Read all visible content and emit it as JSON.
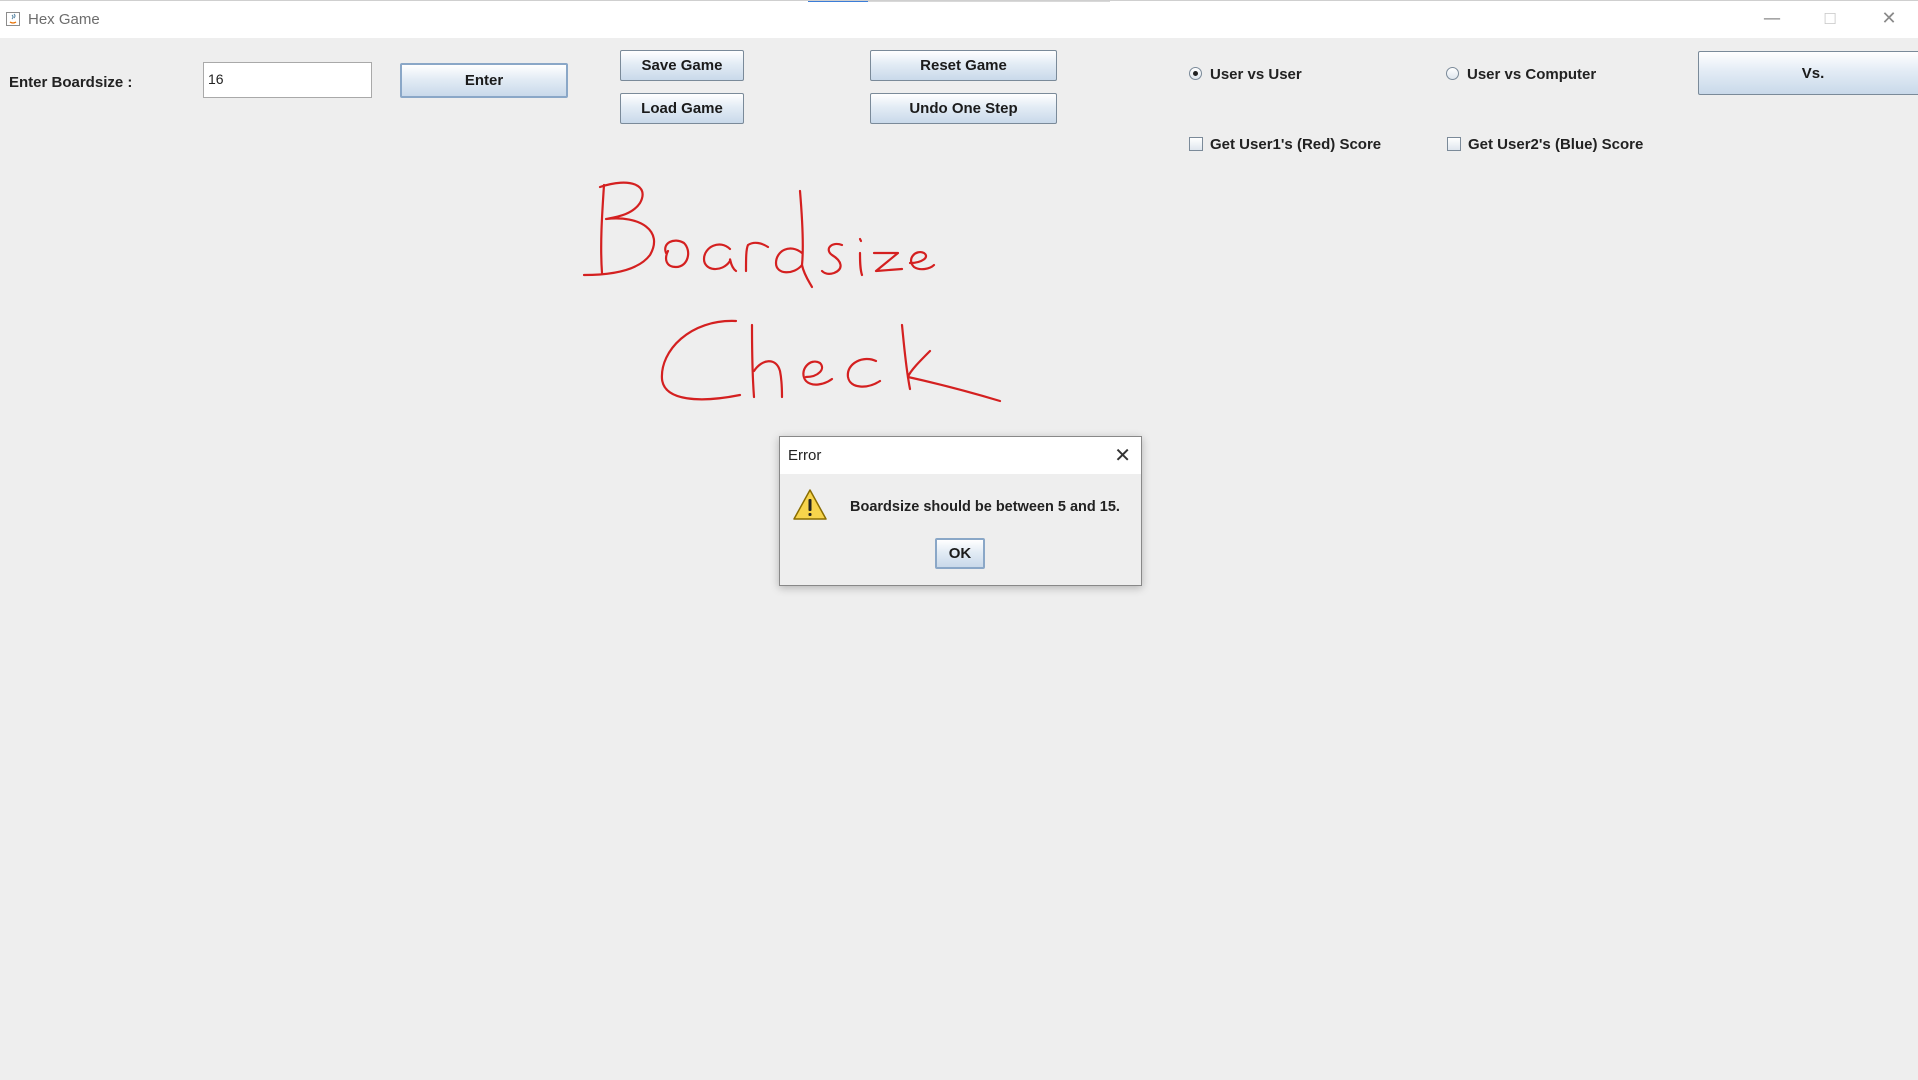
{
  "window": {
    "title": "Hex Game",
    "minimize": "—",
    "maximize": "☐",
    "close": "✕"
  },
  "boardsize": {
    "label": "Enter Boardsize :",
    "value": "16",
    "enter_label": "Enter"
  },
  "buttons": {
    "save": "Save Game",
    "load": "Load Game",
    "reset": "Reset Game",
    "undo": "Undo One Step",
    "vs": "Vs."
  },
  "mode": {
    "options": [
      {
        "label": "User vs User",
        "selected": true
      },
      {
        "label": "User vs Computer",
        "selected": false
      }
    ]
  },
  "scores": {
    "red_label": "Get User1's (Red) Score",
    "blue_label": "Get User2's (Blue) Score",
    "red_checked": false,
    "blue_checked": false
  },
  "annotation": {
    "text": "Boardsize Check",
    "color": "#d42020"
  },
  "dialog": {
    "title": "Error",
    "message": "Boardsize should be between 5 and 15.",
    "ok_label": "OK",
    "icon": "warning-icon"
  }
}
